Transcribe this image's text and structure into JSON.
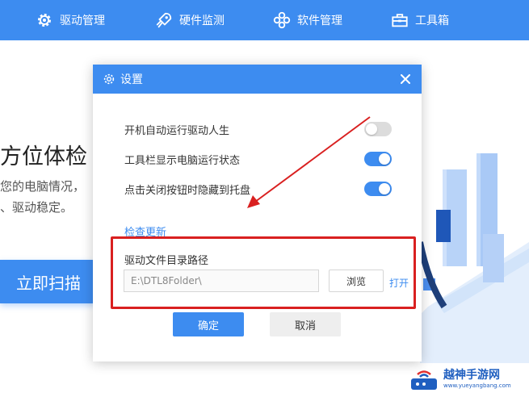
{
  "nav": {
    "items": [
      {
        "label": "驱动管理",
        "icon": "gear-icon"
      },
      {
        "label": "硬件监测",
        "icon": "rocket-icon"
      },
      {
        "label": "软件管理",
        "icon": "apps-icon"
      },
      {
        "label": "工具箱",
        "icon": "toolbox-icon"
      }
    ]
  },
  "background": {
    "title": "方位体检",
    "desc_line1": "您的电脑情况，",
    "desc_line2": "、驱动稳定。",
    "scan_button": "立即扫描"
  },
  "dialog": {
    "title": "设置",
    "options": [
      {
        "label": "开机自动运行驱动人生",
        "enabled": false
      },
      {
        "label": "工具栏显示电脑运行状态",
        "enabled": true
      },
      {
        "label": "点击关闭按钮时隐藏到托盘",
        "enabled": true
      }
    ],
    "check_update": "检查更新",
    "driver_path_label": "驱动文件目录路径",
    "driver_path_value": "E:\\DTL8Folder\\",
    "browse_button": "浏览",
    "open_link": "打开",
    "ok_button": "确定",
    "cancel_button": "取消"
  },
  "watermark": {
    "title": "越神手游网",
    "url": "www.yueyangbang.com"
  },
  "colors": {
    "accent": "#3d8cf0",
    "annotation_red": "#d92020",
    "toggle_off": "#dcdcdc"
  }
}
